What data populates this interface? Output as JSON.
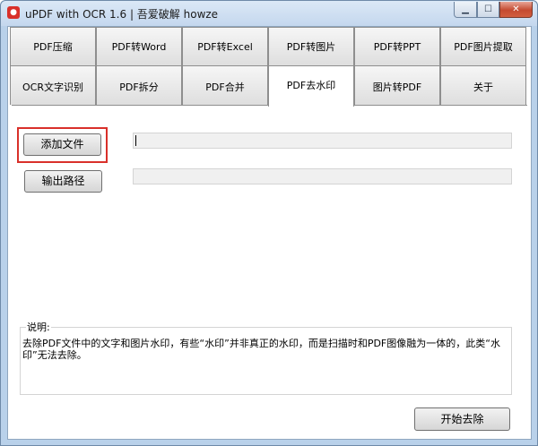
{
  "window": {
    "title": "uPDF with OCR 1.6 |  吾爱破解 howze",
    "app_icon": "pdf-app-icon",
    "controls": {
      "minimize": "▁",
      "maximize": "☐",
      "close": "✕"
    }
  },
  "tabs_row1": [
    {
      "label": "PDF压缩"
    },
    {
      "label": "PDF转Word"
    },
    {
      "label": "PDF转Excel"
    },
    {
      "label": "PDF转图片"
    },
    {
      "label": "PDF转PPT"
    },
    {
      "label": "PDF图片提取"
    }
  ],
  "tabs_row2": [
    {
      "label": "OCR文字识别"
    },
    {
      "label": "PDF拆分"
    },
    {
      "label": "PDF合并"
    },
    {
      "label": "PDF去水印"
    },
    {
      "label": "图片转PDF"
    },
    {
      "label": "关于"
    }
  ],
  "active_tab": "PDF去水印",
  "panel": {
    "add_file_label": "添加文件",
    "file_path_value": "",
    "output_path_label": "输出路径",
    "output_path_value": "",
    "description_title": "说明:",
    "description_text": "去除PDF文件中的文字和图片水印，有些“水印”并非真正的水印，而是扫描时和PDF图像融为一体的，此类“水印”无法去除。",
    "start_button_label": "开始去除"
  },
  "colors": {
    "highlight": "#d9302a",
    "window_frame": "#b9d1ea"
  }
}
